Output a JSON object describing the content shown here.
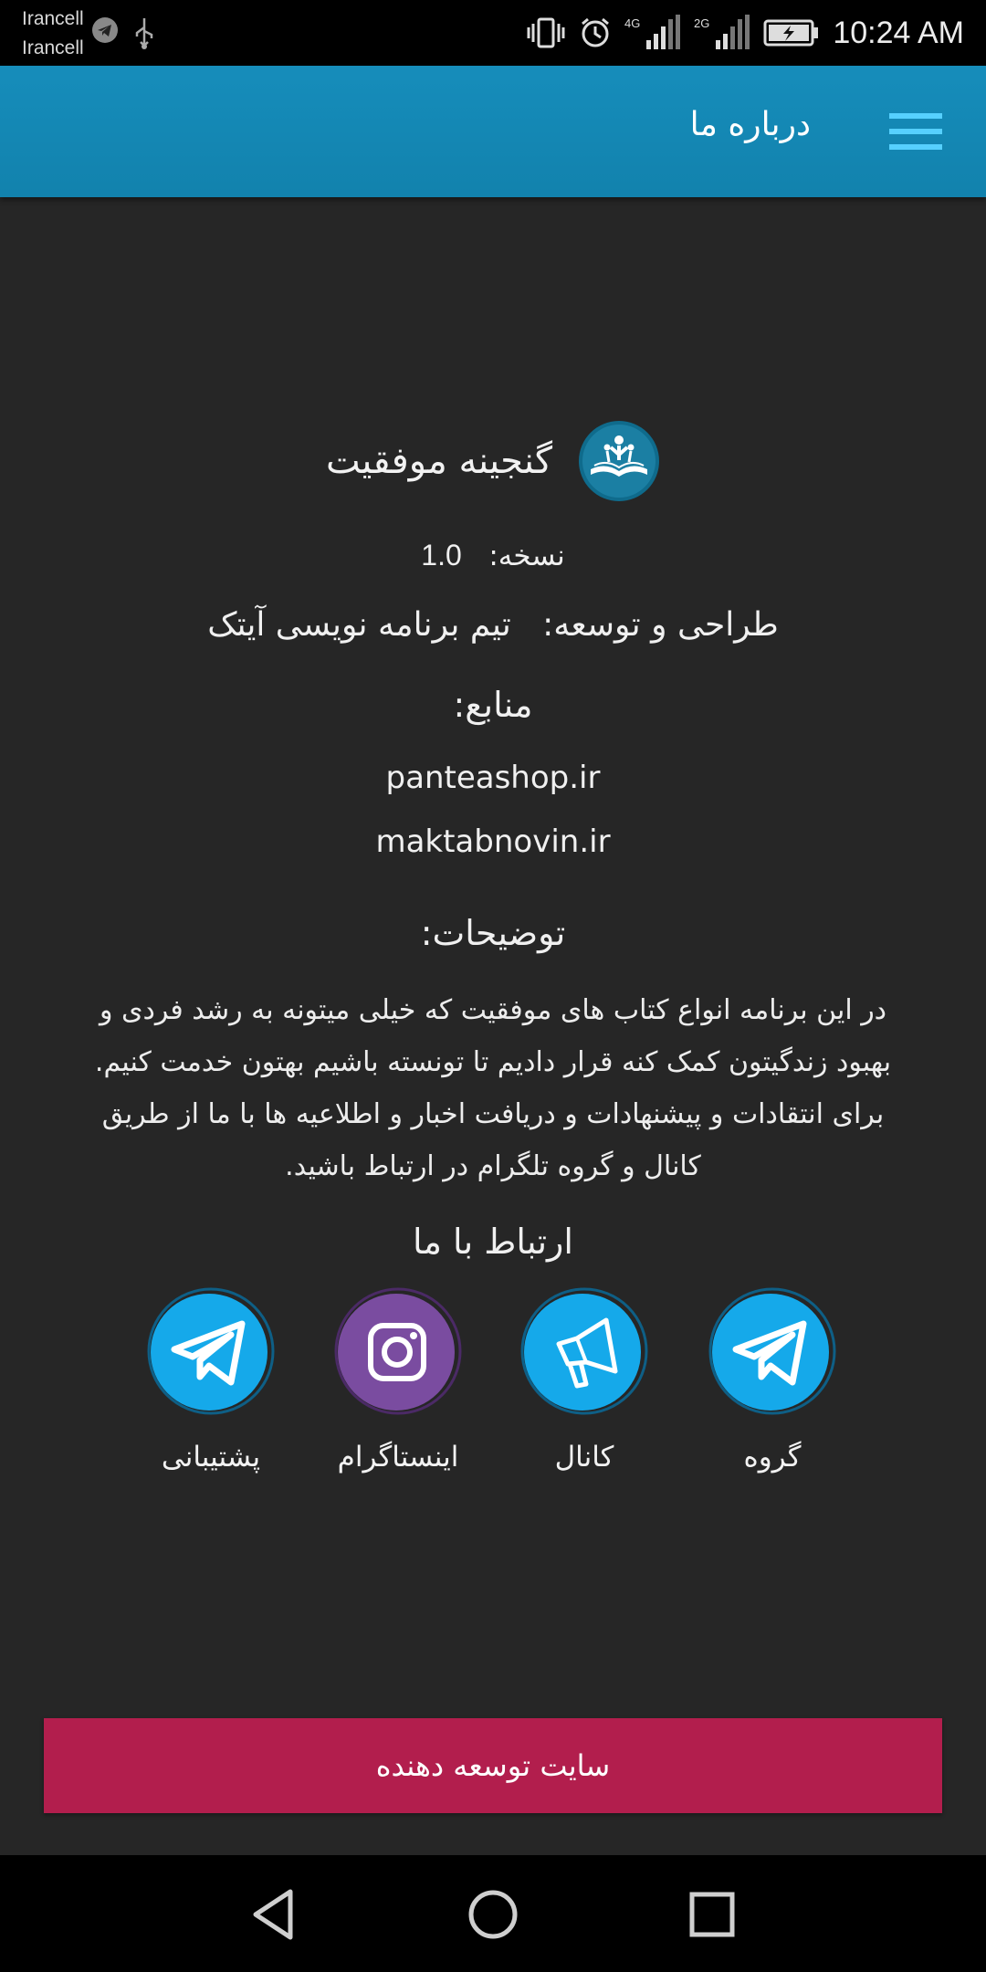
{
  "status_bar": {
    "carrier_1": "Irancell",
    "carrier_2": "Irancell",
    "network_1": "4G",
    "network_2": "2G",
    "time": "10:24 AM",
    "icons": [
      "telegram-icon",
      "usb-icon",
      "vibrate-icon",
      "alarm-icon",
      "signal-icon",
      "battery-charging-icon"
    ]
  },
  "app_bar": {
    "title": "درباره ما",
    "menu_icon": "hamburger-menu-icon"
  },
  "about": {
    "app_name": "گنجینه موفقیت",
    "version_label": "نسخه:",
    "version_value": "1.0",
    "credit_label": "طراحی و توسعه:",
    "credit_value": "تیم برنامه نویسی آیتک",
    "sources_title": "منابع:",
    "sources": [
      "panteashop.ir",
      "maktabnovin.ir"
    ],
    "description_title": "توضیحات:",
    "description": "در این برنامه انواع کتاب های موفقیت که خیلی میتونه به رشد فردی و بهبود زندگیتون کمک کنه قرار دادیم تا تونسته باشیم بهتون خدمت کنیم. برای انتقادات و پیشنهادات و دریافت اخبار و اطلاعیه ها با ما از طریق کانال و گروه تلگرام در ارتباط باشید.",
    "contact_title": "ارتباط با ما"
  },
  "contact_links": [
    {
      "label": "گروه",
      "icon": "telegram-icon",
      "color": "#15a9ea"
    },
    {
      "label": "کانال",
      "icon": "megaphone-icon",
      "color": "#15a9ea"
    },
    {
      "label": "اینستاگرام",
      "icon": "instagram-icon",
      "color": "#7a4ca0"
    },
    {
      "label": "پشتیبانی",
      "icon": "telegram-icon",
      "color": "#15a9ea"
    }
  ],
  "developer_button": {
    "label": "سایت توسعه دهنده",
    "color": "#b21e4d"
  },
  "colors": {
    "app_bar": "#1589b5",
    "background": "#262626",
    "menu_icon": "#56d0ff"
  }
}
